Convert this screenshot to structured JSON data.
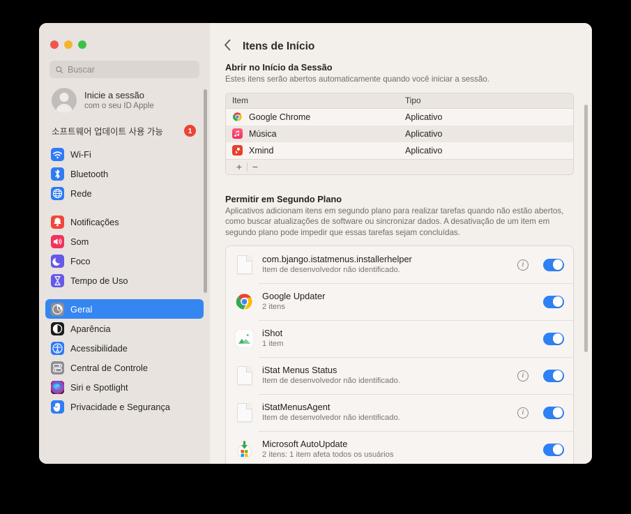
{
  "window": {
    "traffic_lights": [
      "close",
      "minimize",
      "zoom"
    ]
  },
  "sidebar": {
    "search": {
      "placeholder": "Buscar",
      "value": ""
    },
    "account": {
      "line1": "Inicie a sessão",
      "line2": "com o seu ID Apple"
    },
    "update_notice": {
      "label": "소프트웨어 업데이트 사용 가능",
      "badge": "1"
    },
    "groups": [
      {
        "items": [
          {
            "label": "Wi-Fi",
            "icon": "wifi-icon",
            "color": "#2f7bf6",
            "selected": false
          },
          {
            "label": "Bluetooth",
            "icon": "bluetooth-icon",
            "color": "#2f7bf6",
            "selected": false
          },
          {
            "label": "Rede",
            "icon": "globe-icon",
            "color": "#2f7bf6",
            "selected": false
          }
        ]
      },
      {
        "items": [
          {
            "label": "Notificações",
            "icon": "bell-icon",
            "color": "#f3453b",
            "selected": false
          },
          {
            "label": "Som",
            "icon": "speaker-icon",
            "color": "#f2325c",
            "selected": false
          },
          {
            "label": "Foco",
            "icon": "moon-icon",
            "color": "#6559e8",
            "selected": false
          },
          {
            "label": "Tempo de Uso",
            "icon": "hourglass-icon",
            "color": "#6559e8",
            "selected": false
          }
        ]
      },
      {
        "items": [
          {
            "label": "Geral",
            "icon": "gear-icon",
            "color": "#8d8d92",
            "selected": true
          },
          {
            "label": "Aparência",
            "icon": "appearance-icon",
            "color": "#1c1c1e",
            "selected": false
          },
          {
            "label": "Acessibilidade",
            "icon": "accessibility-icon",
            "color": "#2f7bf6",
            "selected": false
          },
          {
            "label": "Central de Controle",
            "icon": "control-center-icon",
            "color": "#8d8d92",
            "selected": false
          },
          {
            "label": "Siri e Spotlight",
            "icon": "siri-icon",
            "color": "#1c1c1e",
            "selected": false
          },
          {
            "label": "Privacidade e Segurança",
            "icon": "hand-icon",
            "color": "#2f7bf6",
            "selected": false
          }
        ]
      }
    ]
  },
  "main": {
    "back_label": "‹",
    "title": "Itens de Início",
    "startup": {
      "title": "Abrir no Início da Sessão",
      "description": "Estes itens serão abertos automaticamente quando você iniciar a sessão.",
      "columns": [
        "Item",
        "Tipo"
      ],
      "rows": [
        {
          "item": "Google Chrome",
          "type": "Aplicativo",
          "icon": "chrome-icon"
        },
        {
          "item": "Música",
          "type": "Aplicativo",
          "icon": "music-icon"
        },
        {
          "item": "Xmind",
          "type": "Aplicativo",
          "icon": "xmind-icon"
        }
      ],
      "add_label": "+",
      "remove_label": "−"
    },
    "background": {
      "title": "Permitir em Segundo Plano",
      "description": "Aplicativos adicionam itens em segundo plano para realizar tarefas quando não estão abertos, como buscar atualizações de software ou sincronizar dados. A desativação de um item em segundo plano pode impedir que essas tarefas sejam concluídas.",
      "items": [
        {
          "name": "com.bjango.istatmenus.installerhelper",
          "subtitle": "Item de desenvolvedor não identificado.",
          "icon": "document-icon",
          "has_info": true,
          "enabled": true
        },
        {
          "name": "Google Updater",
          "subtitle": "2 itens",
          "icon": "chrome-icon",
          "has_info": false,
          "enabled": true
        },
        {
          "name": "iShot",
          "subtitle": "1 item",
          "icon": "ishot-icon",
          "has_info": false,
          "enabled": true
        },
        {
          "name": "iStat Menus Status",
          "subtitle": "Item de desenvolvedor não identificado.",
          "icon": "document-icon",
          "has_info": true,
          "enabled": true
        },
        {
          "name": "iStatMenusAgent",
          "subtitle": "Item de desenvolvedor não identificado.",
          "icon": "document-icon",
          "has_info": true,
          "enabled": true
        },
        {
          "name": "Microsoft AutoUpdate",
          "subtitle": "2 itens: 1 item afeta todos os usuários",
          "icon": "autoupdate-icon",
          "has_info": false,
          "enabled": true
        }
      ]
    }
  },
  "colors": {
    "accent": "#3586f0",
    "toggle_on": "#2f80f5",
    "badge": "#ea4335",
    "sidebar_bg": "#e8e3de",
    "panel_bg": "#f3efeb"
  }
}
